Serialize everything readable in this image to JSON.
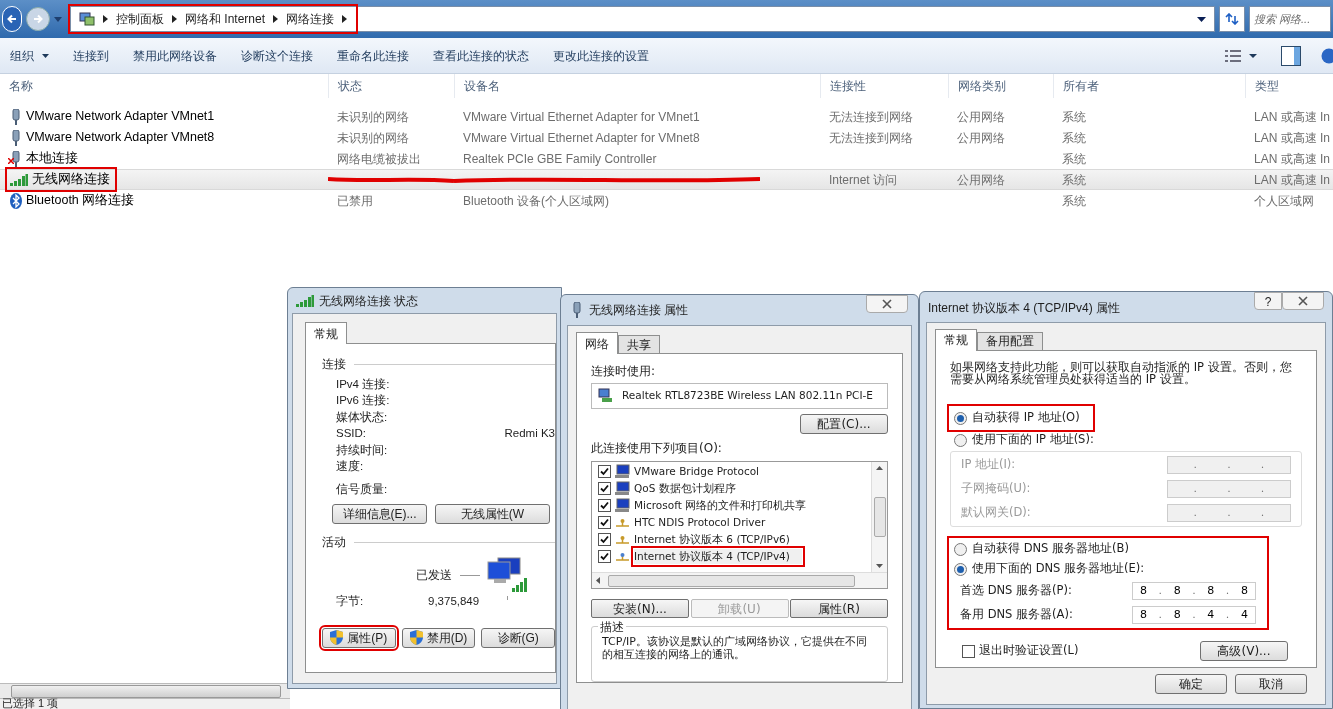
{
  "explorer": {
    "breadcrumbs": [
      {
        "label": "控制面板"
      },
      {
        "label": "网络和 Internet"
      },
      {
        "label": "网络连接"
      }
    ],
    "address_highlighted": true,
    "search": {
      "placeholder": "搜索 网络..."
    },
    "toolbar": [
      {
        "label": "组织",
        "dropdown": true
      },
      {
        "label": "连接到",
        "dropdown": false
      },
      {
        "label": "禁用此网络设备",
        "dropdown": false
      },
      {
        "label": "诊断这个连接",
        "dropdown": false
      },
      {
        "label": "重命名此连接",
        "dropdown": false
      },
      {
        "label": "查看此连接的状态",
        "dropdown": false
      },
      {
        "label": "更改此连接的设置",
        "dropdown": false
      }
    ],
    "columns": [
      "名称",
      "状态",
      "设备名",
      "连接性",
      "网络类别",
      "所有者",
      "类型"
    ],
    "rows": [
      {
        "kind": "adapter",
        "disconnected": false,
        "selected": false,
        "highlighted": false,
        "cells": [
          "VMware Network Adapter VMnet1",
          "未识别的网络",
          "VMware Virtual Ethernet Adapter for VMnet1",
          "无法连接到网络",
          "公用网络",
          "系统",
          "LAN 或高速 In"
        ]
      },
      {
        "kind": "adapter",
        "disconnected": false,
        "selected": false,
        "highlighted": false,
        "cells": [
          "VMware Network Adapter VMnet8",
          "未识别的网络",
          "VMware Virtual Ethernet Adapter for VMnet8",
          "无法连接到网络",
          "公用网络",
          "系统",
          "LAN 或高速 In"
        ]
      },
      {
        "kind": "adapter",
        "disconnected": true,
        "selected": false,
        "highlighted": false,
        "cells": [
          "本地连接",
          "网络电缆被拔出",
          "Realtek PCIe GBE Family Controller",
          "",
          "",
          "系统",
          "LAN 或高速 In"
        ]
      },
      {
        "kind": "wifi",
        "disconnected": false,
        "selected": true,
        "highlighted": true,
        "redacted": true,
        "cells": [
          "无线网络连接",
          "",
          "",
          "Internet 访问",
          "公用网络",
          "系统",
          "LAN 或高速 In"
        ]
      },
      {
        "kind": "bluetooth",
        "disconnected": false,
        "selected": false,
        "highlighted": false,
        "cells": [
          "Bluetooth 网络连接",
          "已禁用",
          "Bluetooth 设备(个人区域网)",
          "",
          "",
          "系统",
          "个人区域网"
        ]
      }
    ],
    "status_bar": "已选择 1 项"
  },
  "status_dialog": {
    "title": "无线网络连接 状态",
    "tabs": [
      {
        "label": "常规",
        "selected": true
      }
    ],
    "connection_group": "连接",
    "fields": [
      {
        "label": "IPv4 连接:"
      },
      {
        "label": "IPv6 连接:"
      },
      {
        "label": "媒体状态:"
      },
      {
        "label": "SSID:",
        "value": "Redmi K3"
      },
      {
        "label": "持续时间:"
      },
      {
        "label": "速度:"
      }
    ],
    "signal_label": "信号质量:",
    "detail_buttons": [
      "详细信息(E)...",
      "无线属性(W"
    ],
    "activity_group": "活动",
    "sent_label": "已发送",
    "bytes_label": "字节:",
    "bytes_sent": "9,375,849",
    "buttons": [
      {
        "label": "属性(P)",
        "shield": true,
        "highlighted": true
      },
      {
        "label": "禁用(D)",
        "shield": true,
        "highlighted": false
      },
      {
        "label": "诊断(G)",
        "shield": false,
        "highlighted": false
      }
    ]
  },
  "properties_dialog": {
    "title": "无线网络连接 属性",
    "tabs": [
      {
        "label": "网络",
        "selected": true
      },
      {
        "label": "共享",
        "selected": false
      }
    ],
    "connect_using_label": "连接时使用:",
    "adapter": "Realtek RTL8723BE Wireless LAN 802.11n PCI-E",
    "configure_button": "配置(C)...",
    "items_label": "此连接使用下列项目(O):",
    "items": [
      {
        "kind": "client",
        "checked": true,
        "highlighted": false,
        "label": "VMware Bridge Protocol"
      },
      {
        "kind": "client",
        "checked": true,
        "highlighted": false,
        "label": "QoS 数据包计划程序"
      },
      {
        "kind": "client",
        "checked": true,
        "highlighted": false,
        "label": "Microsoft 网络的文件和打印机共享"
      },
      {
        "kind": "protocol",
        "checked": true,
        "highlighted": false,
        "label": "HTC NDIS Protocol Driver"
      },
      {
        "kind": "protocol",
        "checked": true,
        "highlighted": false,
        "label": "Internet 协议版本 6 (TCP/IPv6)"
      },
      {
        "kind": "protocol",
        "checked": true,
        "highlighted": true,
        "label": "Internet 协议版本 4 (TCP/IPv4)"
      }
    ],
    "buttons": [
      {
        "label": "安装(N)...",
        "disabled": false
      },
      {
        "label": "卸载(U)",
        "disabled": true
      },
      {
        "label": "属性(R)",
        "disabled": false
      }
    ],
    "description_group": "描述",
    "description": "TCP/IP。该协议是默认的广域网络协议，它提供在不同的相互连接的网络上的通讯。"
  },
  "ipv4_dialog": {
    "title": "Internet 协议版本 4 (TCP/IPv4) 属性",
    "help_button": "?",
    "octet_separator": ".",
    "tabs": [
      {
        "label": "常规",
        "selected": true
      },
      {
        "label": "备用配置",
        "selected": false
      }
    ],
    "intro": "如果网络支持此功能，则可以获取自动指派的 IP 设置。否则，您需要从网络系统管理员处获得适当的 IP 设置。",
    "ip_options": [
      {
        "label": "自动获得 IP 地址(O)",
        "selected": true,
        "highlighted": true
      },
      {
        "label": "使用下面的 IP 地址(S):",
        "selected": false,
        "highlighted": false
      }
    ],
    "ip_fields": [
      {
        "label": "IP 地址(I):",
        "disabled": true
      },
      {
        "label": "子网掩码(U):",
        "disabled": true
      },
      {
        "label": "默认网关(D):",
        "disabled": true
      }
    ],
    "dns_options": [
      {
        "label": "自动获得 DNS 服务器地址(B)",
        "selected": false
      },
      {
        "label": "使用下面的 DNS 服务器地址(E):",
        "selected": true
      }
    ],
    "dns_highlighted": true,
    "dns_fields": [
      {
        "label": "首选 DNS 服务器(P):",
        "octets": [
          "8",
          "8",
          "8",
          "8"
        ],
        "disabled": false
      },
      {
        "label": "备用 DNS 服务器(A):",
        "octets": [
          "8",
          "8",
          "4",
          "4"
        ],
        "disabled": false
      }
    ],
    "validate": {
      "label": "退出时验证设置(L)",
      "checked": false
    },
    "advanced_button": "高级(V)...",
    "buttons": [
      "确定",
      "取消"
    ]
  }
}
